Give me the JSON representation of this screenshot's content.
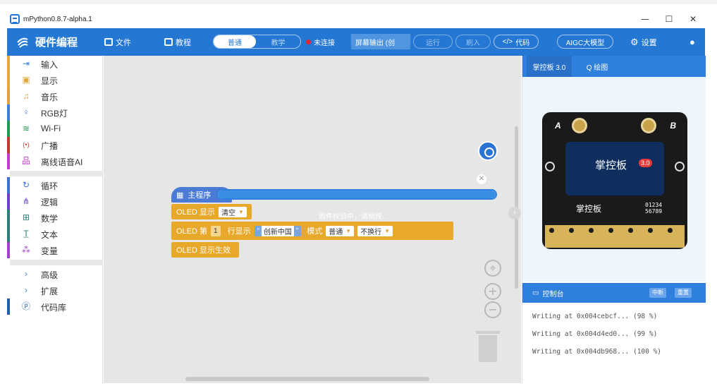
{
  "window": {
    "title": "mPython0.8.7-alpha.1",
    "controls": [
      "—",
      "☐",
      "✕"
    ]
  },
  "toolbar": {
    "brand": "硬件编程",
    "file": "文件",
    "tutorial": "教程",
    "mode_normal": "普通",
    "mode_teach": "教学",
    "connection": "未连接",
    "screen_output": "屏幕输出 (创",
    "run": "运行",
    "flash": "刷入",
    "code": "代码",
    "aigc": "AIGC大模型",
    "settings": "设置",
    "accent": "#2478d4"
  },
  "sidebar": {
    "groups": [
      [
        {
          "label": "输入",
          "icon": "input-icon",
          "color": "#e7a63a"
        },
        {
          "label": "显示",
          "icon": "display-icon",
          "color": "#e7a63a"
        },
        {
          "label": "音乐",
          "icon": "music-icon",
          "color": "#e2a040"
        },
        {
          "label": "RGB灯",
          "icon": "bulb-icon",
          "color": "#3f7ed6"
        },
        {
          "label": "Wi-Fi",
          "icon": "wifi-icon",
          "color": "#1f9a52"
        },
        {
          "label": "广播",
          "icon": "broadcast-icon",
          "color": "#c0392b"
        },
        {
          "label": "离线语音AI",
          "icon": "network-icon",
          "color": "#c13ac9"
        }
      ],
      [
        {
          "label": "循环",
          "icon": "loop-icon",
          "color": "#3b6fd0"
        },
        {
          "label": "逻辑",
          "icon": "logic-icon",
          "color": "#6a3fc9"
        },
        {
          "label": "数学",
          "icon": "math-icon",
          "color": "#2e7d76"
        },
        {
          "label": "文本",
          "icon": "text-icon",
          "color": "#2e7d76"
        },
        {
          "label": "变量",
          "icon": "variable-icon",
          "color": "#a23fd0"
        }
      ],
      [
        {
          "label": "高级",
          "icon": "chevron-right-icon",
          "color": "#ffffff"
        },
        {
          "label": "扩展",
          "icon": "chevron-right-icon",
          "color": "#ffffff"
        },
        {
          "label": "代码库",
          "icon": "code-lib-icon",
          "color": "#1f5fa8"
        }
      ]
    ]
  },
  "workspace": {
    "hat_block": "主程序",
    "oled_show": "OLED 显示",
    "clear": "清空",
    "oled_line": "OLED 第",
    "line_num": "1",
    "line_show": "行显示",
    "quote_open": "“",
    "string_value": "创新中国",
    "quote_close": "”",
    "mode_label": "模式",
    "mode_value": "普通",
    "wrap_value": "不换行",
    "oled_apply": "OLED 显示生效",
    "progress_percent": 100,
    "progress_text": "固件校验中，请稍候..."
  },
  "right_panel": {
    "tab_board": "掌控板 3.0",
    "tab_draw": "Q 绘图",
    "board": {
      "oled_text": "掌控板",
      "badge": "3.0",
      "logo": "掌控板",
      "nums_1": "01234",
      "nums_2": "56789",
      "label_a": "A",
      "label_b": "B"
    },
    "console": {
      "title": "控制台",
      "btn_stop": "中断",
      "btn_reset": "重置",
      "logs": [
        "Writing at 0x004cebcf... (98 %)",
        "Writing at 0x004d4ed0... (99 %)",
        "Writing at 0x004db968... (100 %)"
      ]
    }
  }
}
